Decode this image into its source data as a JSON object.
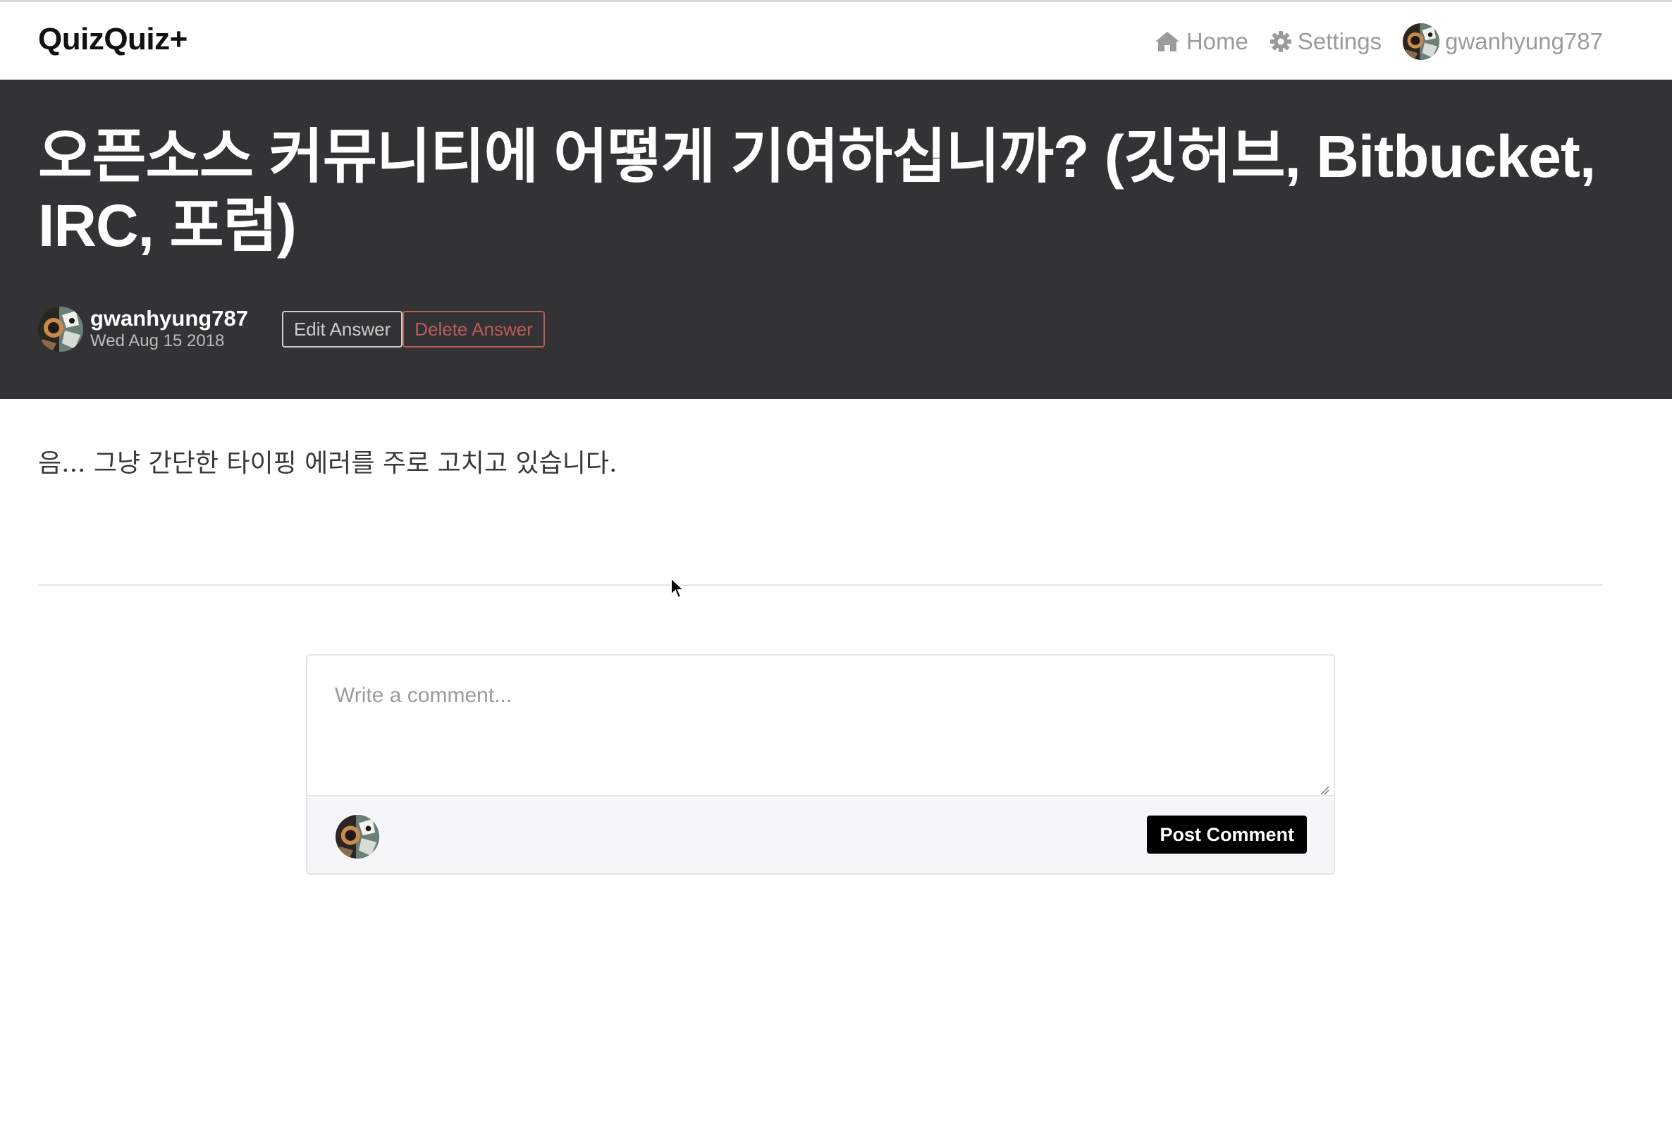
{
  "navbar": {
    "brand": "QuizQuiz+",
    "links": [
      {
        "label": "Home",
        "icon": "home-icon"
      },
      {
        "label": "Settings",
        "icon": "gear-icon"
      }
    ],
    "username": "gwanhyung787"
  },
  "article": {
    "title": "오픈소스 커뮤니티에 어떻게 기여하십니까? (깃허브, Bitbucket, IRC, 포럼)",
    "author": "gwanhyung787",
    "date": "Wed Aug 15 2018",
    "edit_label": "Edit Answer",
    "delete_label": "Delete Answer",
    "body": "음... 그냥 간단한 타이핑 에러를 주로 고치고 있습니다."
  },
  "comment": {
    "placeholder": "Write a comment...",
    "post_label": "Post Comment"
  },
  "colors": {
    "banner_bg": "#333235",
    "delete_accent": "#b85c5c",
    "post_button_bg": "#000000"
  }
}
